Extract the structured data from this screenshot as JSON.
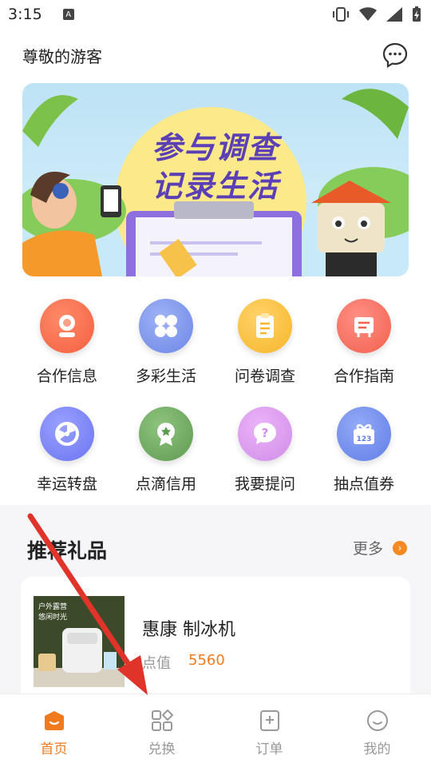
{
  "status_bar": {
    "time": "3:15"
  },
  "header": {
    "greeting": "尊敬的游客"
  },
  "banner": {
    "line1": "参与调查",
    "line2": "记录生活"
  },
  "features": [
    {
      "label": "合作信息",
      "icon": "profile-icon",
      "color": "#f2603f"
    },
    {
      "label": "多彩生活",
      "icon": "grid-flower-icon",
      "color": "#6c86e6"
    },
    {
      "label": "问卷调查",
      "icon": "clipboard-icon",
      "color": "#f6b52a"
    },
    {
      "label": "合作指南",
      "icon": "guide-icon",
      "color": "#f2614c"
    },
    {
      "label": "幸运转盘",
      "icon": "wheel-icon",
      "color": "#6a74f0"
    },
    {
      "label": "点滴信用",
      "icon": "award-icon",
      "color": "#5f9a52"
    },
    {
      "label": "我要提问",
      "icon": "question-icon",
      "color": "#d18ce8"
    },
    {
      "label": "抽点值券",
      "icon": "gift-coupon-icon",
      "color": "#5f7de6"
    }
  ],
  "recommend": {
    "title": "推荐礼品",
    "more": "更多",
    "product": {
      "name": "惠康 制冰机",
      "points_label": "点值",
      "points": "5560",
      "image_text_1": "户外露营",
      "image_text_2": "悠闲时光"
    }
  },
  "tabs": [
    {
      "label": "首页",
      "icon": "home-icon",
      "active": true
    },
    {
      "label": "兑换",
      "icon": "exchange-icon",
      "active": false
    },
    {
      "label": "订单",
      "icon": "order-icon",
      "active": false
    },
    {
      "label": "我的",
      "icon": "smile-user-icon",
      "active": false
    }
  ],
  "colors": {
    "accent": "#f07b1f",
    "banner_title": "#5a3fb5",
    "annotation_arrow": "#e0342a"
  }
}
